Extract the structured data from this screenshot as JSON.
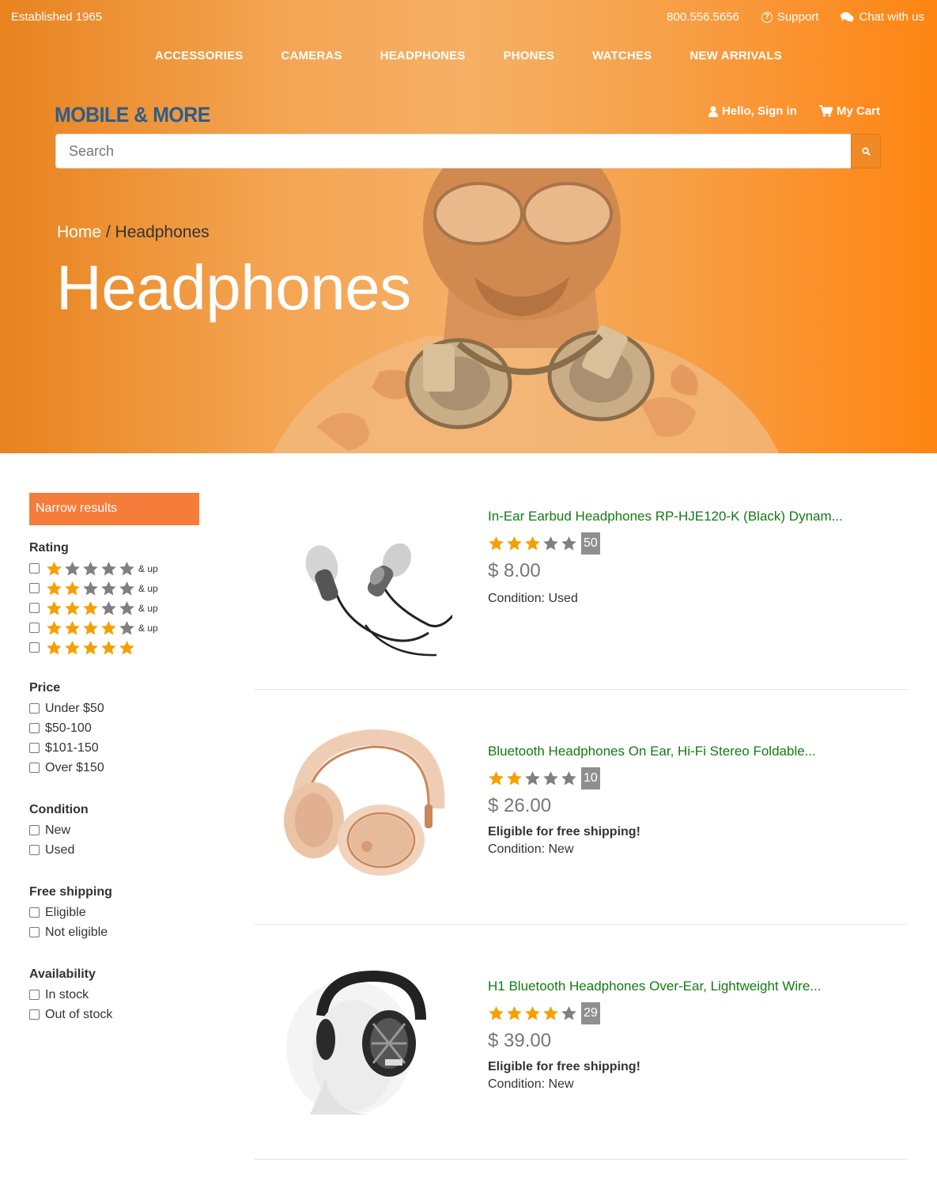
{
  "topbar": {
    "established": "Established 1965",
    "phone": "800.556.5656",
    "support": "Support",
    "chat": "Chat with us"
  },
  "nav": [
    "ACCESSORIES",
    "CAMERAS",
    "HEADPHONES",
    "PHONES",
    "WATCHES",
    "NEW ARRIVALS"
  ],
  "brand": "MOBILE & MORE",
  "account": {
    "signin": "Hello, Sign in",
    "cart": "My Cart"
  },
  "search": {
    "placeholder": "Search",
    "value": ""
  },
  "breadcrumb": {
    "home": "Home",
    "separator": " / ",
    "current": "Headphones"
  },
  "page_title": "Headphones",
  "sidebar": {
    "header": "Narrow results",
    "rating": {
      "title": "Rating",
      "options": [
        {
          "stars": 1,
          "suffix": "& up"
        },
        {
          "stars": 2,
          "suffix": "& up"
        },
        {
          "stars": 3,
          "suffix": "& up"
        },
        {
          "stars": 4,
          "suffix": "& up"
        },
        {
          "stars": 5,
          "suffix": ""
        }
      ]
    },
    "price": {
      "title": "Price",
      "options": [
        "Under $50",
        "$50-100",
        "$101-150",
        "Over $150"
      ]
    },
    "condition": {
      "title": "Condition",
      "options": [
        "New",
        "Used"
      ]
    },
    "shipping": {
      "title": "Free shipping",
      "options": [
        "Eligible",
        "Not eligible"
      ]
    },
    "availability": {
      "title": "Availability",
      "options": [
        "In stock",
        "Out of stock"
      ]
    }
  },
  "products": [
    {
      "title": "In-Ear Earbud Headphones RP-HJE120-K (Black) Dynam...",
      "rating": 3,
      "reviews": "50",
      "price": "$ 8.00",
      "shipping": "",
      "condition": "Condition: Used",
      "image": "earbuds"
    },
    {
      "title": "Bluetooth Headphones On Ear, Hi-Fi Stereo Foldable...",
      "rating": 2,
      "reviews": "10",
      "price": "$ 26.00",
      "shipping": "Eligible for free shipping!",
      "condition": "Condition: New",
      "image": "on-ear-headphones"
    },
    {
      "title": "H1 Bluetooth Headphones Over-Ear, Lightweight Wire...",
      "rating": 4,
      "reviews": "29",
      "price": "$ 39.00",
      "shipping": "Eligible for free shipping!",
      "condition": "Condition: New",
      "image": "over-ear-headphones"
    }
  ],
  "colors": {
    "accent_orange": "#f57d3b",
    "brand_blue": "#2c5d8c",
    "link_green": "#137a13",
    "star_filled": "#f5a000",
    "star_empty": "#808080"
  }
}
